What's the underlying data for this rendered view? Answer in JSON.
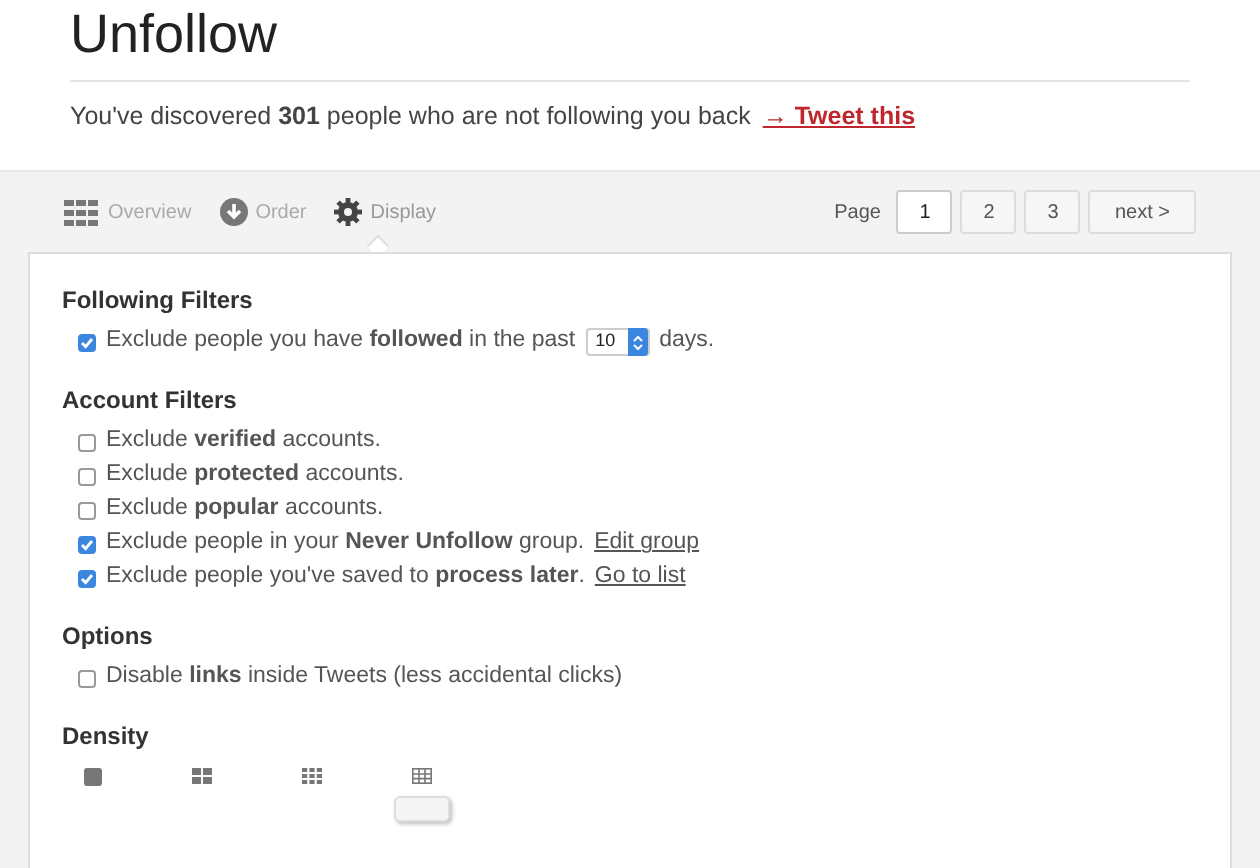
{
  "title": "Unfollow",
  "summary": "You've discovered **301** people who are not following you back",
  "tweet_link": "→ Tweet this",
  "tabs": [
    {
      "label": "Overview",
      "kind": "grid",
      "selected": false
    },
    {
      "label": "Order",
      "kind": "arrow",
      "selected": false
    },
    {
      "label": "Display",
      "kind": "gear",
      "selected": true
    }
  ],
  "pagination": {
    "label": "Page",
    "pages": [
      {
        "label": "1",
        "selected": true
      },
      {
        "label": "2",
        "selected": false
      },
      {
        "label": "3",
        "selected": false
      }
    ],
    "next": "next >"
  },
  "sections": [
    {
      "heading": "Following Filters",
      "options": [
        {
          "text": "Exclude people you have **followed** in the past",
          "checked": true,
          "stepper": {
            "value": "10",
            "suffix": "days."
          }
        }
      ]
    },
    {
      "heading": "Account Filters",
      "options": [
        {
          "text": "Exclude **verified** accounts.",
          "checked": false
        },
        {
          "text": "Exclude **protected** accounts.",
          "checked": false
        },
        {
          "text": "Exclude **popular** accounts.",
          "checked": false
        },
        {
          "text": "Exclude people in your **Never Unfollow** group.",
          "checked": true,
          "link": "Edit group"
        },
        {
          "text": "Exclude people you've saved to **process later**.",
          "checked": true,
          "link": "Go to list"
        }
      ]
    },
    {
      "heading": "Options",
      "options": [
        {
          "text": "Disable **links** inside Tweets (less accidental clicks)",
          "checked": false
        }
      ]
    }
  ],
  "density": {
    "heading": "Density",
    "options": [
      {
        "kind": "single",
        "selected": false
      },
      {
        "kind": "four",
        "selected": false
      },
      {
        "kind": "nine",
        "selected": false
      },
      {
        "kind": "table",
        "selected": true
      }
    ]
  }
}
